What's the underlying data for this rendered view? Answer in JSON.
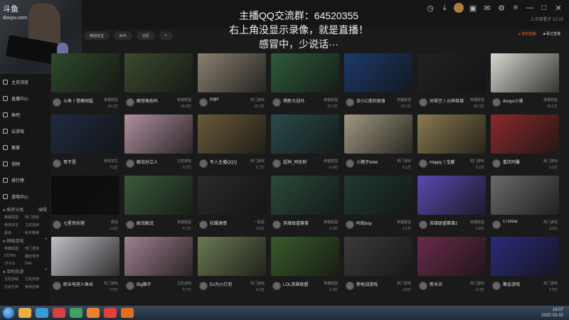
{
  "logo": "斗鱼",
  "webcam": {
    "label": "斗鱼",
    "sublabel": "douyu.com"
  },
  "overlay": {
    "line1": "主播QQ交流群：64520355",
    "line2": "右上角没显示录像，就是直播！",
    "line3": "感冒中，少说话···"
  },
  "top_sub": "上次观看于 12:13",
  "filters": [
    "特别关注",
    "iN卡",
    "分区",
    "+"
  ],
  "right_actions": [
    "● 我的直播",
    "■ 看过直播"
  ],
  "sidebar": {
    "items": [
      {
        "label": "主页浏览",
        "icon": "home-icon"
      },
      {
        "label": "直播中心",
        "icon": "broadcast-icon"
      },
      {
        "label": "鱼吧",
        "icon": "fish-icon"
      },
      {
        "label": "云游戏",
        "icon": "cloud-game-icon"
      },
      {
        "label": "赛事",
        "icon": "trophy-icon"
      },
      {
        "label": "视频",
        "icon": "video-icon"
      },
      {
        "label": "排行榜",
        "icon": "rank-icon"
      },
      {
        "label": "游戏中心",
        "icon": "gamepad-icon"
      }
    ],
    "sections": [
      {
        "title": "● 推荐分类",
        "action": "编辑",
        "subs": [
          "英雄联盟",
          "热门游戏",
          "绝地求生",
          "主机游戏",
          "颜值",
          "和平精英"
        ]
      },
      {
        "title": "● 网络游戏",
        "action": "+",
        "subs": [
          "英雄联盟",
          "热门游戏",
          "DOTA2",
          "魔兽世界",
          "CF/CS",
          "DNF"
        ]
      },
      {
        "title": "● 单机热游",
        "action": "+",
        "subs": [
          "主机游戏",
          "主机热游",
          "方舟生存",
          "使命召唤"
        ]
      }
    ]
  },
  "cards": [
    {
      "name": "斗鱼丨登峰刚猛",
      "tag": "英雄联盟",
      "views": "14.1万",
      "color": "#2e4a2a"
    },
    {
      "name": "解锁角色吗",
      "tag": "英雄联盟",
      "views": "26.4万",
      "color": "#3a4a2e"
    },
    {
      "name": "piglif",
      "tag": "热门游戏",
      "views": "16.2万",
      "color": "#8a8070"
    },
    {
      "name": "萌新大战马",
      "tag": "英雄联盟",
      "views": "12.3万",
      "color": "#2f5a3a"
    },
    {
      "name": "余小C真的很强",
      "tag": "英雄联盟",
      "views": "23.7万",
      "color": "#1c3a6a"
    },
    {
      "name": "孙悟空丨元神英雄",
      "tag": "英雄联盟",
      "views": "32.3万",
      "color": "#222"
    },
    {
      "name": "douyu小溪",
      "tag": "英雄联盟",
      "views": "26.1万",
      "color": "#d8d8d0"
    },
    {
      "name": "哥不是",
      "tag": "绝地求生",
      "views": "7.5万",
      "color": "#202a40"
    },
    {
      "name": "解说孙立人",
      "tag": "主机游戏",
      "views": "8.2万",
      "color": "#b090a0"
    },
    {
      "name": "冬人主播QQQ",
      "tag": "热门游戏",
      "views": "6.7万",
      "color": "#6a5a3a"
    },
    {
      "name": "超神_阿伦射",
      "tag": "英雄联盟",
      "views": "6.4万",
      "color": "#2a4a4a"
    },
    {
      "name": "小猪子tinkk",
      "tag": "热门游戏",
      "views": "5.1万",
      "color": "#a09880"
    },
    {
      "name": "Happy丨宝藏",
      "tag": "热门游戏",
      "views": "5.5万",
      "color": "#8a7a50"
    },
    {
      "name": "重庆阿雕",
      "tag": "热门游戏",
      "views": "3.2万",
      "color": "#8a2a2a"
    },
    {
      "name": "七星快乐猪",
      "tag": "颜值",
      "views": "1.6万",
      "color": "#0c0c0c"
    },
    {
      "name": "解说解说",
      "tag": "英雄联盟",
      "views": "6.7万",
      "color": "#3a5a3a"
    },
    {
      "name": "狂躁激情",
      "tag": "一起看",
      "views": "3.5万",
      "color": "#2a2a2a"
    },
    {
      "name": "英雄联盟赛事",
      "tag": "英雄联盟",
      "views": "3.2万",
      "color": "#2a4a3a"
    },
    {
      "name": "阿凯boy",
      "tag": "英雄联盟",
      "views": "4.1万",
      "color": "#203a30"
    },
    {
      "name": "英雄联盟赛事2",
      "tag": "英雄联盟",
      "views": "2.8万",
      "color": "#5a4ab0"
    },
    {
      "name": "17show",
      "tag": "热门游戏",
      "views": "3.5万",
      "color": "#6a6a6a"
    },
    {
      "name": "职业电竞人鱼丝",
      "tag": "热门游戏",
      "views": "2.6万",
      "color": "#c0c0c8"
    },
    {
      "name": "Big箱子",
      "tag": "主机游戏",
      "views": "5.7万",
      "color": "#a08090"
    },
    {
      "name": "Ev为小灯泡",
      "tag": "热门游戏",
      "views": "4.2万",
      "color": "#6a7a50"
    },
    {
      "name": "LOL英雄联盟",
      "tag": "英雄联盟",
      "views": "6.0万",
      "color": "#3a5a2a"
    },
    {
      "name": "新枪战游戏",
      "tag": "热门游戏",
      "views": "2.8万",
      "color": "#3a3a3a"
    },
    {
      "name": "新水浒",
      "tag": "热门游戏",
      "views": "3.3万",
      "color": "#6a2a4a"
    },
    {
      "name": "聚会游戏",
      "tag": "热门游戏",
      "views": "2.9万",
      "color": "#2a2a7a"
    }
  ],
  "tray": {
    "time": "16:07",
    "date": "2022-03-02"
  }
}
